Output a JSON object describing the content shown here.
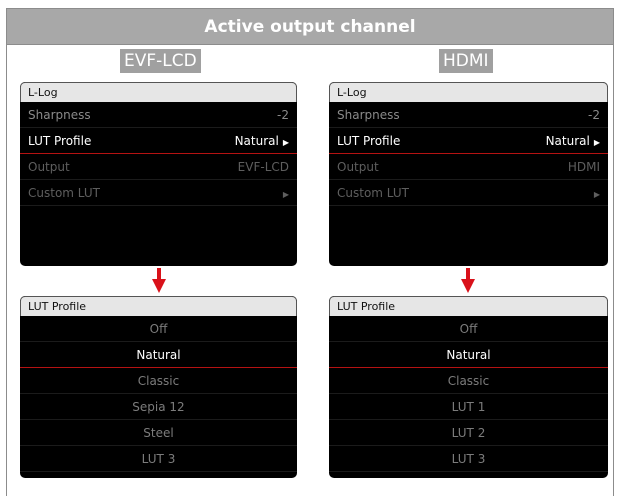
{
  "header": {
    "title": "Active output channel"
  },
  "colors": {
    "accent": "#d9111a",
    "screen_bg": "#000000",
    "header_bg": "#a8a8a8"
  },
  "left": {
    "channel": "EVF-LCD",
    "menu": {
      "title": "L-Log",
      "rows": [
        {
          "label": "Sharpness",
          "value": "-2"
        },
        {
          "label": "LUT Profile",
          "value": "Natural"
        },
        {
          "label": "Output",
          "value": "EVF-LCD"
        },
        {
          "label": "Custom LUT",
          "value": ""
        }
      ]
    },
    "submenu": {
      "title": "LUT Profile",
      "options": [
        "Off",
        "Natural",
        "Classic",
        "Sepia 12",
        "Steel",
        "LUT 3"
      ],
      "selected": "Natural"
    }
  },
  "right": {
    "channel": "HDMI",
    "menu": {
      "title": "L-Log",
      "rows": [
        {
          "label": "Sharpness",
          "value": "-2"
        },
        {
          "label": "LUT Profile",
          "value": "Natural"
        },
        {
          "label": "Output",
          "value": "HDMI"
        },
        {
          "label": "Custom LUT",
          "value": ""
        }
      ]
    },
    "submenu": {
      "title": "LUT Profile",
      "options": [
        "Off",
        "Natural",
        "Classic",
        "LUT 1",
        "LUT 2",
        "LUT 3"
      ],
      "selected": "Natural"
    }
  },
  "icons": {
    "submenu": "chevron-right-icon",
    "flow": "arrow-down-icon"
  }
}
